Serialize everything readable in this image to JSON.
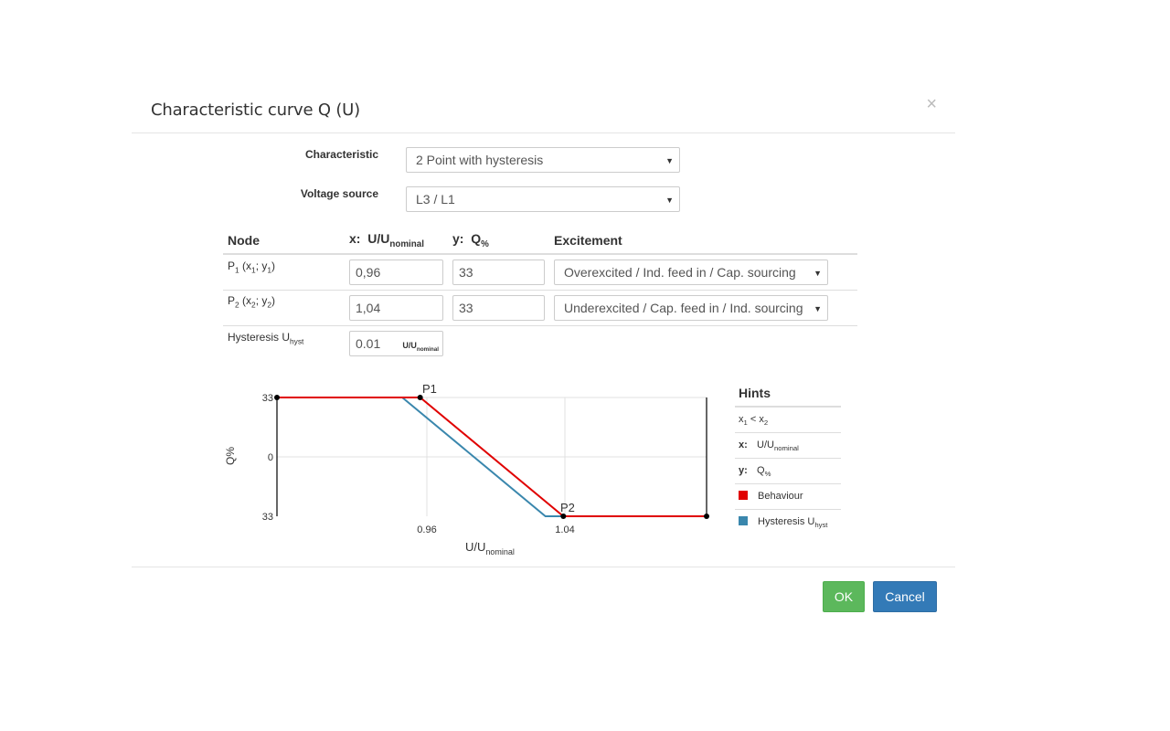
{
  "dialog": {
    "title": "Characteristic curve Q (U)",
    "close_glyph": "×"
  },
  "form": {
    "characteristic_label": "Characteristic",
    "characteristic_value": "2 Point with hysteresis",
    "voltage_source_label": "Voltage source",
    "voltage_source_value": "L3 / L1"
  },
  "table": {
    "col_node": "Node",
    "col_x_prefix": "x:",
    "col_x_main": "U/U",
    "col_x_sub": "nominal",
    "col_y_prefix": "y:",
    "col_y_main": "Q",
    "col_y_sub": "%",
    "col_excitement": "Excitement",
    "rows": [
      {
        "label_main": "P",
        "label_sub": "1",
        "label_rest_open": " (x",
        "xsub": "1",
        "sep": "; y",
        "ysub": "1",
        "close": ")",
        "x": "0,96",
        "y": "33",
        "excitement": "Overexcited / Ind. feed in / Cap. sourcing"
      },
      {
        "label_main": "P",
        "label_sub": "2",
        "label_rest_open": " (x",
        "xsub": "2",
        "sep": "; y",
        "ysub": "2",
        "close": ")",
        "x": "1,04",
        "y": "33",
        "excitement": "Underexcited / Cap. feed in / Ind. sourcing"
      }
    ],
    "hysteresis_label_main": "Hysteresis U",
    "hysteresis_label_sub": "hyst",
    "hysteresis_value": "0.01",
    "hysteresis_unit_main": "U/U",
    "hysteresis_unit_sub": "nominal"
  },
  "chart_data": {
    "type": "line",
    "xlabel_main": "U/U",
    "xlabel_sub": "nominal",
    "ylabel": "Q%",
    "x_ticks": [
      "0.96",
      "1.04"
    ],
    "y_ticks": [
      "33",
      "0",
      "33"
    ],
    "point_labels": [
      "P1",
      "P2"
    ],
    "series": [
      {
        "name": "Behaviour",
        "color": "#e00000",
        "points": [
          [
            0.88,
            33
          ],
          [
            0.96,
            33
          ],
          [
            1.04,
            -33
          ],
          [
            1.12,
            -33
          ]
        ]
      },
      {
        "name": "Hysteresis U",
        "color": "#3a87ad",
        "points": [
          [
            0.95,
            33
          ],
          [
            1.03,
            -33
          ],
          [
            1.04,
            -33
          ]
        ]
      }
    ],
    "xlim": [
      0.88,
      1.12
    ],
    "ylim": [
      -33,
      33
    ],
    "grid": true
  },
  "hints": {
    "title": "Hints",
    "rule_main": "x",
    "rule_sub1": "1",
    "rule_mid": " < x",
    "rule_sub2": "2",
    "x_key": "x:",
    "x_main": "U/U",
    "x_sub": "nominal",
    "y_key": "y:",
    "y_main": "Q",
    "y_sub": "%",
    "behaviour_label": "Behaviour",
    "behaviour_color": "#e00000",
    "hysteresis_main": "Hysteresis U",
    "hysteresis_sub": "hyst",
    "hysteresis_color": "#3a87ad"
  },
  "buttons": {
    "ok": "OK",
    "cancel": "Cancel"
  }
}
